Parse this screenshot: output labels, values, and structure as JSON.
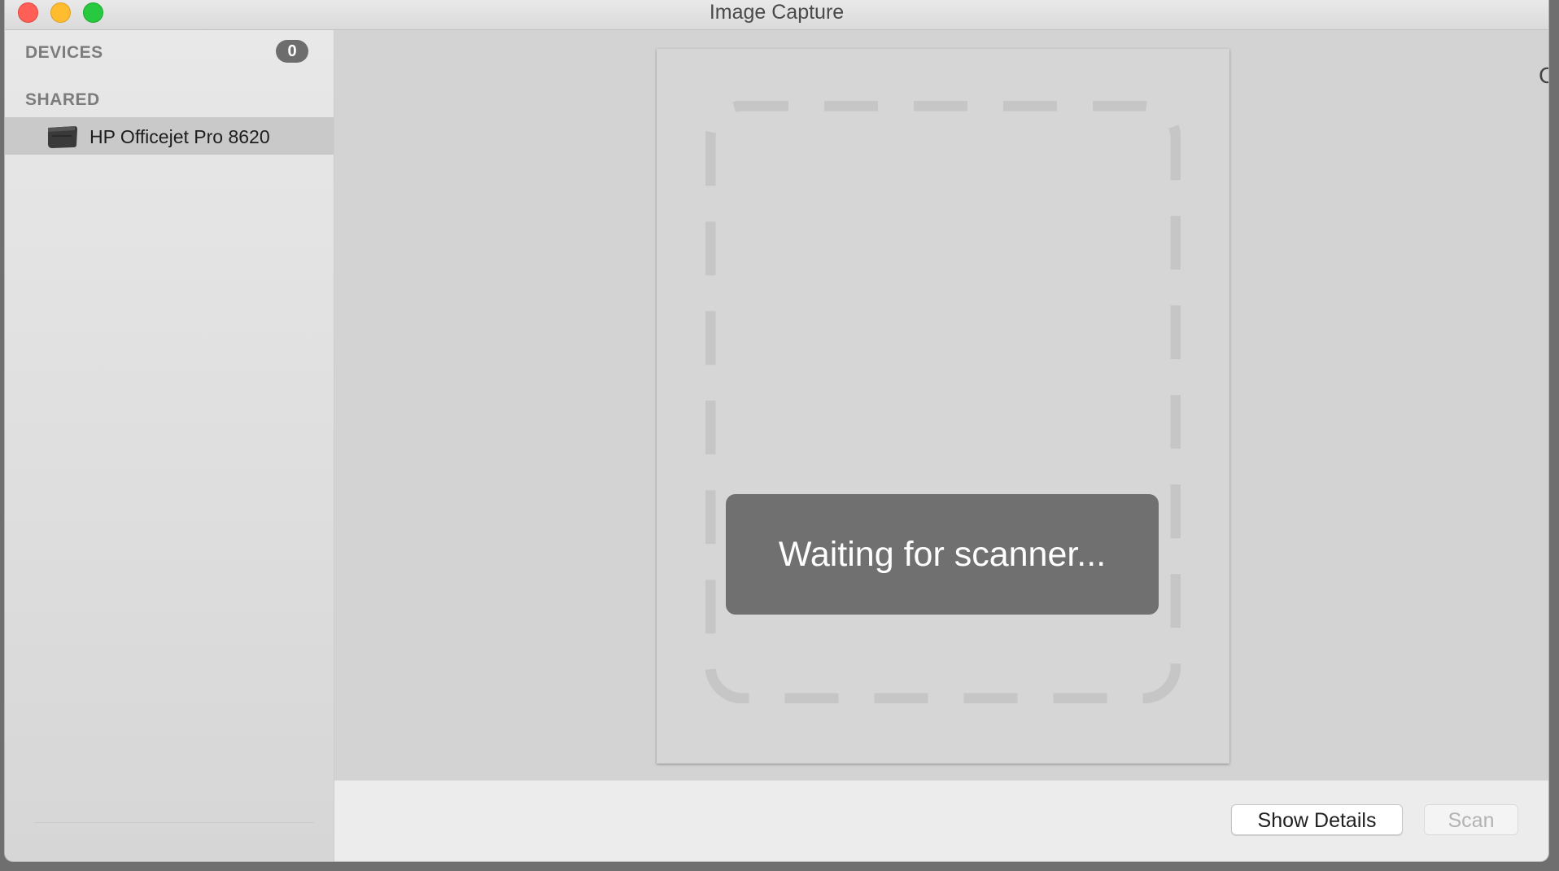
{
  "window": {
    "title": "Image Capture"
  },
  "sidebar": {
    "devices_header": "DEVICES",
    "devices_count": "0",
    "shared_header": "SHARED",
    "shared_items": [
      {
        "label": "HP Officejet Pro 8620",
        "icon": "printer-icon",
        "selected": true
      }
    ]
  },
  "main": {
    "status_message": "Waiting for scanner...",
    "edge_text": "C"
  },
  "footer": {
    "show_details_label": "Show Details",
    "scan_label": "Scan",
    "scan_enabled": false
  },
  "colors": {
    "close": "#ff5f57",
    "minimize": "#febc2e",
    "maximize": "#28c840",
    "overlay": "#707070",
    "badge": "#6d6d6d"
  }
}
